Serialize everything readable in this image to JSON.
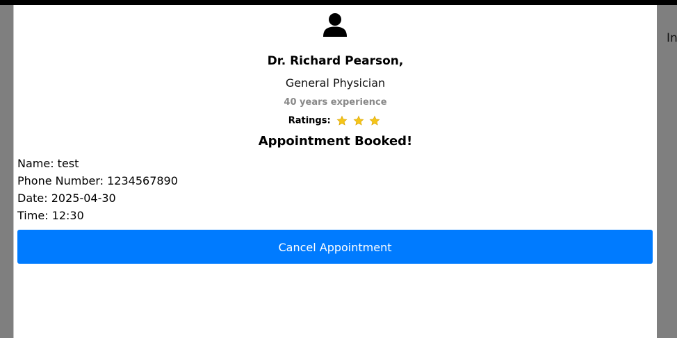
{
  "background": {
    "partial_text": "In"
  },
  "doctor": {
    "name": "Dr. Richard Pearson,",
    "speciality": "General Physician",
    "experience": "40 years experience",
    "ratings_label": "Ratings:",
    "star_count": 3,
    "star_color": "#f5c518"
  },
  "confirmation": {
    "title": "Appointment Booked!"
  },
  "booking": {
    "name": "Name: test",
    "phone": "Phone Number: 1234567890",
    "date": "Date: 2025-04-30",
    "time": "Time: 12:30"
  },
  "actions": {
    "cancel_label": "Cancel Appointment",
    "cancel_color": "#007bff"
  },
  "icons": {
    "avatar": "user-icon",
    "star": "star-icon"
  }
}
